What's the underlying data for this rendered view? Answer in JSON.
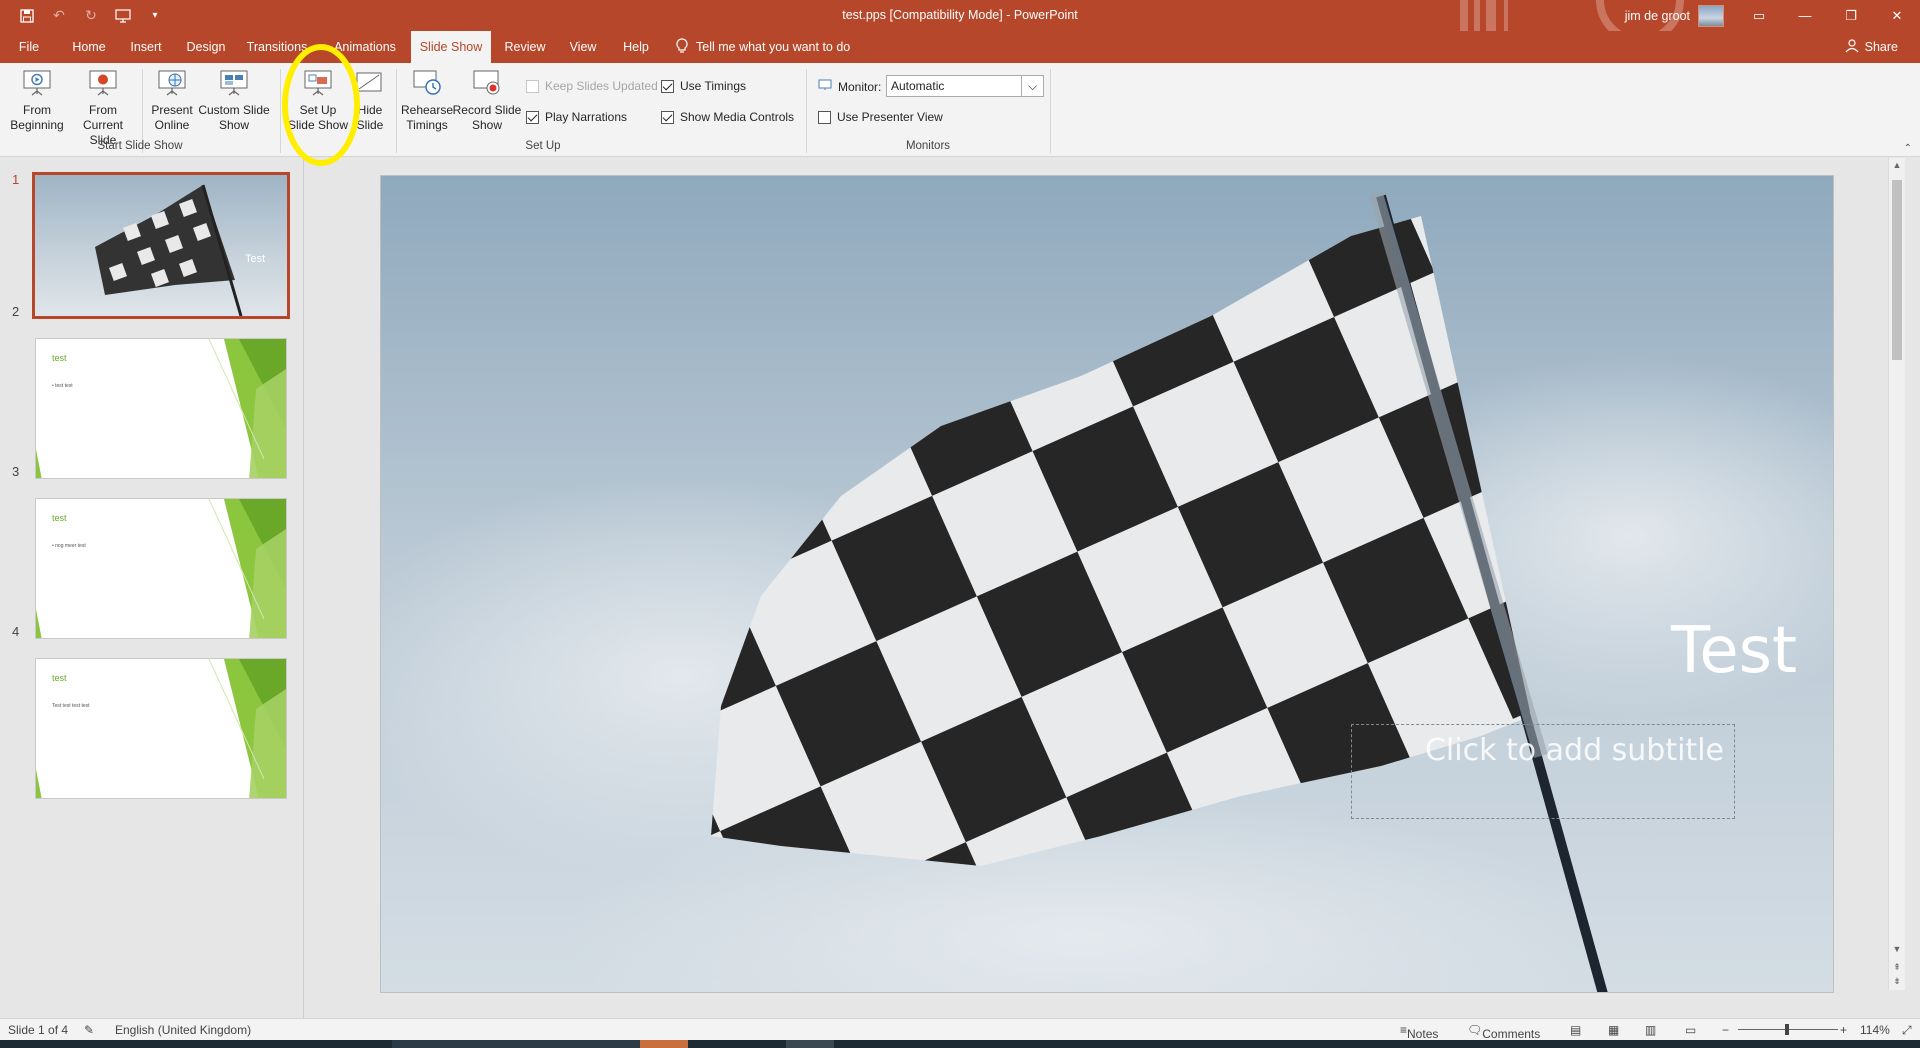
{
  "window": {
    "title": "test.pps [Compatibility Mode]  -  PowerPoint",
    "user_name": "jim de groot"
  },
  "quick_access": [
    "save-icon",
    "undo-icon",
    "redo-icon",
    "from-beginning-icon",
    "customize-icon"
  ],
  "menu": {
    "tabs": [
      "File",
      "Home",
      "Insert",
      "Design",
      "Transitions",
      "Animations",
      "Slide Show",
      "Review",
      "View",
      "Help"
    ],
    "active_tab": "Slide Show",
    "tell_me": "Tell me what you want to do",
    "share": "Share"
  },
  "ribbon": {
    "from_beginning": "From Beginning",
    "from_current": "From Current Slide",
    "present_online": "Present Online",
    "custom_show": "Custom Slide Show",
    "group_start": "Start Slide Show",
    "setup_show": "Set Up Slide Show",
    "hide_slide": "Hide Slide",
    "rehearse": "Rehearse Timings",
    "record": "Record Slide Show",
    "keep_updated": "Keep Slides Updated",
    "play_narrations": "Play Narrations",
    "use_timings": "Use Timings",
    "show_media": "Show Media Controls",
    "group_setup": "Set Up",
    "monitor_label": "Monitor:",
    "monitor_value": "Automatic",
    "presenter_view": "Use Presenter View",
    "group_monitors": "Monitors",
    "checks": {
      "keep_updated": false,
      "play_narrations": true,
      "use_timings": true,
      "show_media": true,
      "presenter_view": false
    }
  },
  "slides": [
    {
      "number": "1",
      "title": "Test",
      "selected": true
    },
    {
      "number": "2",
      "title": "test",
      "body": "• test test"
    },
    {
      "number": "3",
      "title": "test",
      "body": "• nog meer test"
    },
    {
      "number": "4",
      "title": "test",
      "body": "Test test test test"
    }
  ],
  "current_slide": {
    "title": "Test",
    "subtitle_placeholder": "Click to add subtitle"
  },
  "status": {
    "slide_info": "Slide 1 of 4",
    "language": "English (United Kingdom)",
    "notes": "Notes",
    "comments": "Comments",
    "zoom": "114%"
  },
  "colors": {
    "accent": "#b7472a",
    "highlight": "#ffee00",
    "theme_green": "#6aa82a"
  }
}
